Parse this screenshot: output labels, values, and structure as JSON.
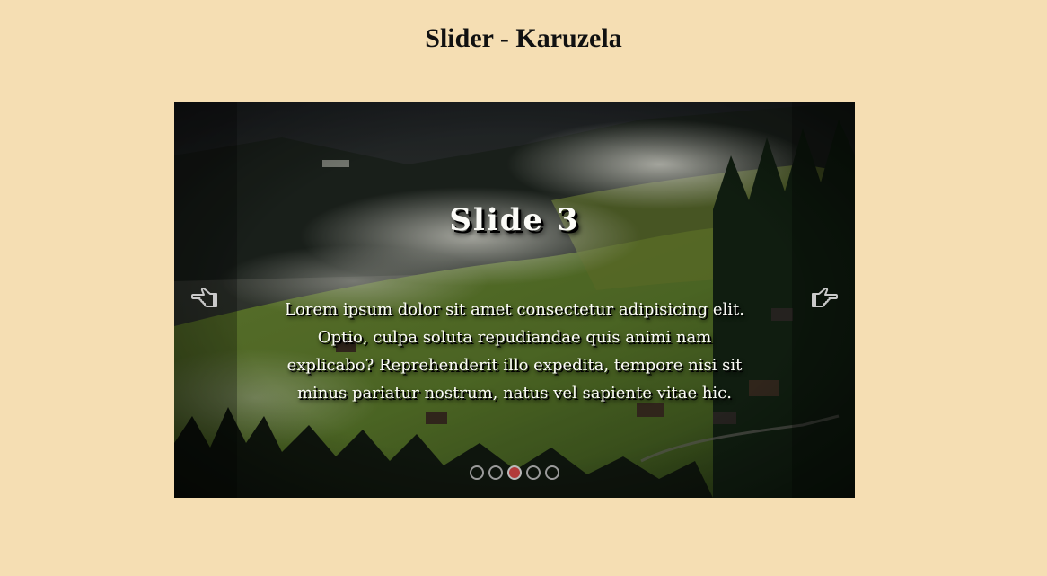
{
  "page": {
    "title": "Slider - Karuzela"
  },
  "slider": {
    "current_slide": 3,
    "total_slides": 5,
    "slide_title": "Slide 3",
    "slide_text": "Lorem ipsum dolor sit amet consectetur adipisicing elit. Optio, culpa soluta repudiandae quis animi nam explicabo? Reprehenderit illo expedita, tempore nisi sit minus pariatur nostrum, natus vel sapiente vitae hic.",
    "prev_icon": "hand-pointing-left-icon",
    "next_icon": "hand-pointing-right-icon",
    "image_subject": "misty mountain valley with forest and houses",
    "colors": {
      "page_background": "#f5deb3",
      "active_dot": "#b23a3a",
      "dot_border": "#9a9a9a",
      "slide_text": "#fbfbf7"
    }
  }
}
